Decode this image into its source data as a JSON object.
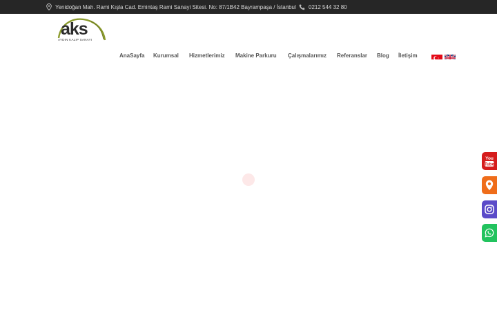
{
  "topbar": {
    "address": "Yenidoğan Mah. Rami Kışla Cad. Emintaş Rami Sanayi Sitesi. No: 87/1B42 Bayrampaşa / İstanbul",
    "phone": "0212 544 32 80",
    "address_icon": "map-pin-icon",
    "phone_icon": "phone-icon"
  },
  "logo": {
    "word": "aks",
    "tagline": "AYDIN KALIP SANAYI",
    "accent_color": "#8a9a2b"
  },
  "nav": {
    "items": [
      "AnaSayfa",
      "Kurumsal",
      "Hizmetlerimiz",
      "Makine Parkuru",
      "Çalışmalarımız",
      "Referanslar",
      "Blog",
      "İletişim"
    ]
  },
  "languages": [
    "turkish-flag-icon",
    "uk-flag-icon"
  ],
  "social": {
    "youtube_label": "You Tube",
    "colors": {
      "youtube": "#d51c1c",
      "location": "#ef6d1a",
      "instagram": "#5b4bc9",
      "whatsapp": "#22c35e"
    }
  }
}
